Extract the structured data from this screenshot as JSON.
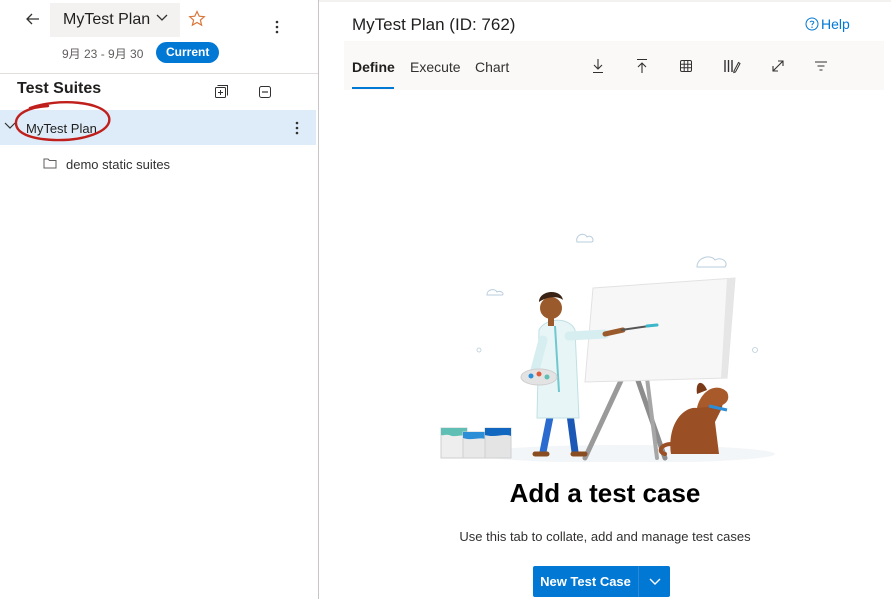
{
  "header": {
    "plan_name": "MyTest Plan",
    "iteration": "9月 23 - 9月 30",
    "badge": "Current"
  },
  "sidebar": {
    "title": "Test Suites",
    "root": {
      "label": "MyTest Plan"
    },
    "children": [
      {
        "label": "demo static suites"
      }
    ]
  },
  "main": {
    "title": "MyTest Plan (ID: 762)",
    "help": "Help",
    "tabs": [
      {
        "label": "Define",
        "active": true
      },
      {
        "label": "Execute",
        "active": false
      },
      {
        "label": "Chart",
        "active": false
      }
    ],
    "toolbar_icons": [
      "download-icon",
      "upload-icon",
      "grid-icon",
      "column-options-icon",
      "fullscreen-icon",
      "filter-icon"
    ],
    "empty_state": {
      "title": "Add a test case",
      "description": "Use this tab to collate, add and manage test cases"
    },
    "new_button": "New Test Case"
  },
  "colors": {
    "accent": "#0078d4",
    "selected_row": "#deecf9",
    "annotation": "#c0201c"
  }
}
